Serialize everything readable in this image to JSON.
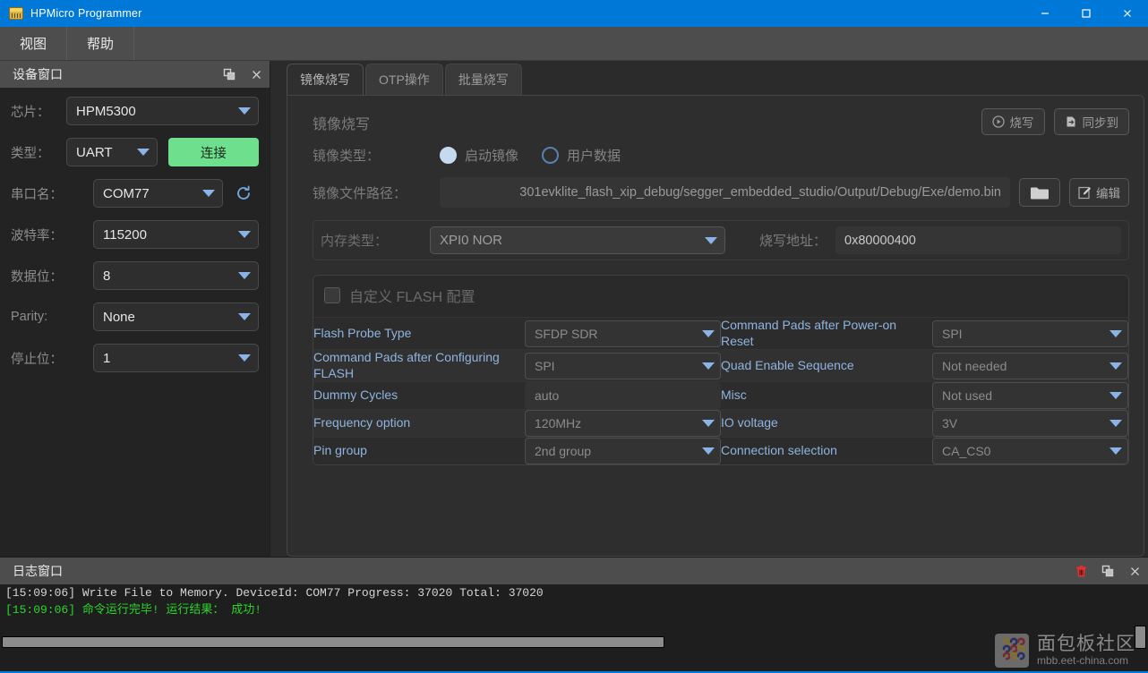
{
  "window": {
    "title": "HPMicro Programmer",
    "icon": "app-icon",
    "minimize": "–",
    "maximize": "□",
    "close": "✕"
  },
  "menubar": {
    "items": [
      {
        "label": "视图",
        "name": "menu-view"
      },
      {
        "label": "帮助",
        "name": "menu-help"
      }
    ]
  },
  "device_dock": {
    "title": "设备窗口",
    "float_icon": "float-icon",
    "close_icon": "close-icon",
    "fields": {
      "chip_label": "芯片：",
      "chip_value": "HPM5300",
      "type_label": "类型：",
      "type_value": "UART",
      "connect_label": "连接",
      "port_label": "串口名：",
      "port_value": "COM77",
      "refresh_icon": "refresh-icon",
      "baud_label": "波特率：",
      "baud_value": "115200",
      "databits_label": "数据位：",
      "databits_value": "8",
      "parity_label": "Parity:",
      "parity_value": "None",
      "stopbits_label": "停止位：",
      "stopbits_value": "1"
    }
  },
  "main": {
    "tabs": [
      {
        "label": "镜像烧写",
        "active": true
      },
      {
        "label": "OTP操作",
        "active": false
      },
      {
        "label": "批量烧写",
        "active": false
      }
    ],
    "panel_title": "镜像烧写",
    "actions": {
      "program_label": "烧写",
      "program_icon": "play-circle-icon",
      "sync_label": "同步到",
      "sync_icon": "file-export-icon"
    },
    "image_type": {
      "label": "镜像类型：",
      "options": [
        {
          "label": "启动镜像",
          "checked": true
        },
        {
          "label": "用户数据",
          "checked": false
        }
      ]
    },
    "file_path": {
      "label": "镜像文件路径：",
      "value": "301evklite_flash_xip_debug/segger_embedded_studio/Output/Debug/Exe/demo.bin",
      "browse_icon": "folder-icon",
      "edit_label": "编辑",
      "edit_icon": "pencil-icon"
    },
    "memory": {
      "type_label": "内存类型：",
      "type_value": "XPI0 NOR",
      "address_label": "烧写地址：",
      "address_value": "0x80000400"
    },
    "flash_config": {
      "checkbox_label": "自定义 FLASH 配置",
      "checked": false,
      "rows": [
        {
          "left_label": "Flash Probe Type",
          "left_value": "SFDP SDR",
          "left_type": "select",
          "right_label": "Command Pads after Power-on Reset",
          "right_value": "SPI",
          "right_type": "select"
        },
        {
          "left_label": "Command Pads after Configuring FLASH",
          "left_value": "SPI",
          "left_type": "select",
          "right_label": "Quad Enable Sequence",
          "right_value": "Not needed",
          "right_type": "select"
        },
        {
          "left_label": "Dummy Cycles",
          "left_value": "auto",
          "left_type": "text",
          "right_label": "Misc",
          "right_value": "Not used",
          "right_type": "select"
        },
        {
          "left_label": "Frequency option",
          "left_value": "120MHz",
          "left_type": "select",
          "right_label": "IO voltage",
          "right_value": "3V",
          "right_type": "select"
        },
        {
          "left_label": "Pin group",
          "left_value": "2nd group",
          "left_type": "select",
          "right_label": "Connection selection",
          "right_value": "CA_CS0",
          "right_type": "select"
        }
      ]
    }
  },
  "log_dock": {
    "title": "日志窗口",
    "clear_icon": "trash-icon",
    "float_icon": "float-icon",
    "close_icon": "close-icon",
    "lines": [
      {
        "text": "[15:09:06] Write File to Memory. DeviceId: COM77 Progress: 37020 Total: 37020",
        "level": "info"
      },
      {
        "text": "[15:09:06] 命令运行完毕! 运行结果： 成功!",
        "level": "ok"
      }
    ]
  },
  "watermark": {
    "cn": "面包板社区",
    "en": "mbb.eet-china.com"
  },
  "colors": {
    "titlebar": "#0078d7",
    "accent_green": "#6ee08d",
    "log_ok": "#2bd62b",
    "label_blue": "#8fb4e0",
    "trash_red": "#e03030"
  }
}
